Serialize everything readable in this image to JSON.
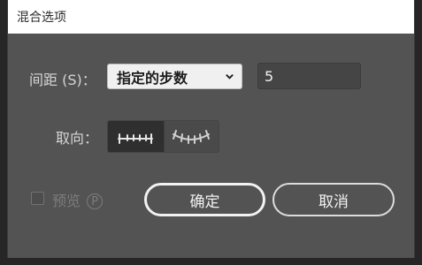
{
  "window": {
    "title": "混合选项"
  },
  "spacing": {
    "label": "间距 (S)：",
    "mode_selected": "指定的步数",
    "steps_value": "5"
  },
  "orientation": {
    "label": "取向：",
    "options": [
      {
        "icon": "align-to-page-icon",
        "selected": true
      },
      {
        "icon": "align-to-path-icon",
        "selected": false
      }
    ]
  },
  "preview": {
    "label": "预览",
    "shortcut": "P",
    "checked": false
  },
  "buttons": {
    "ok_label": "确定",
    "cancel_label": "取消"
  }
}
